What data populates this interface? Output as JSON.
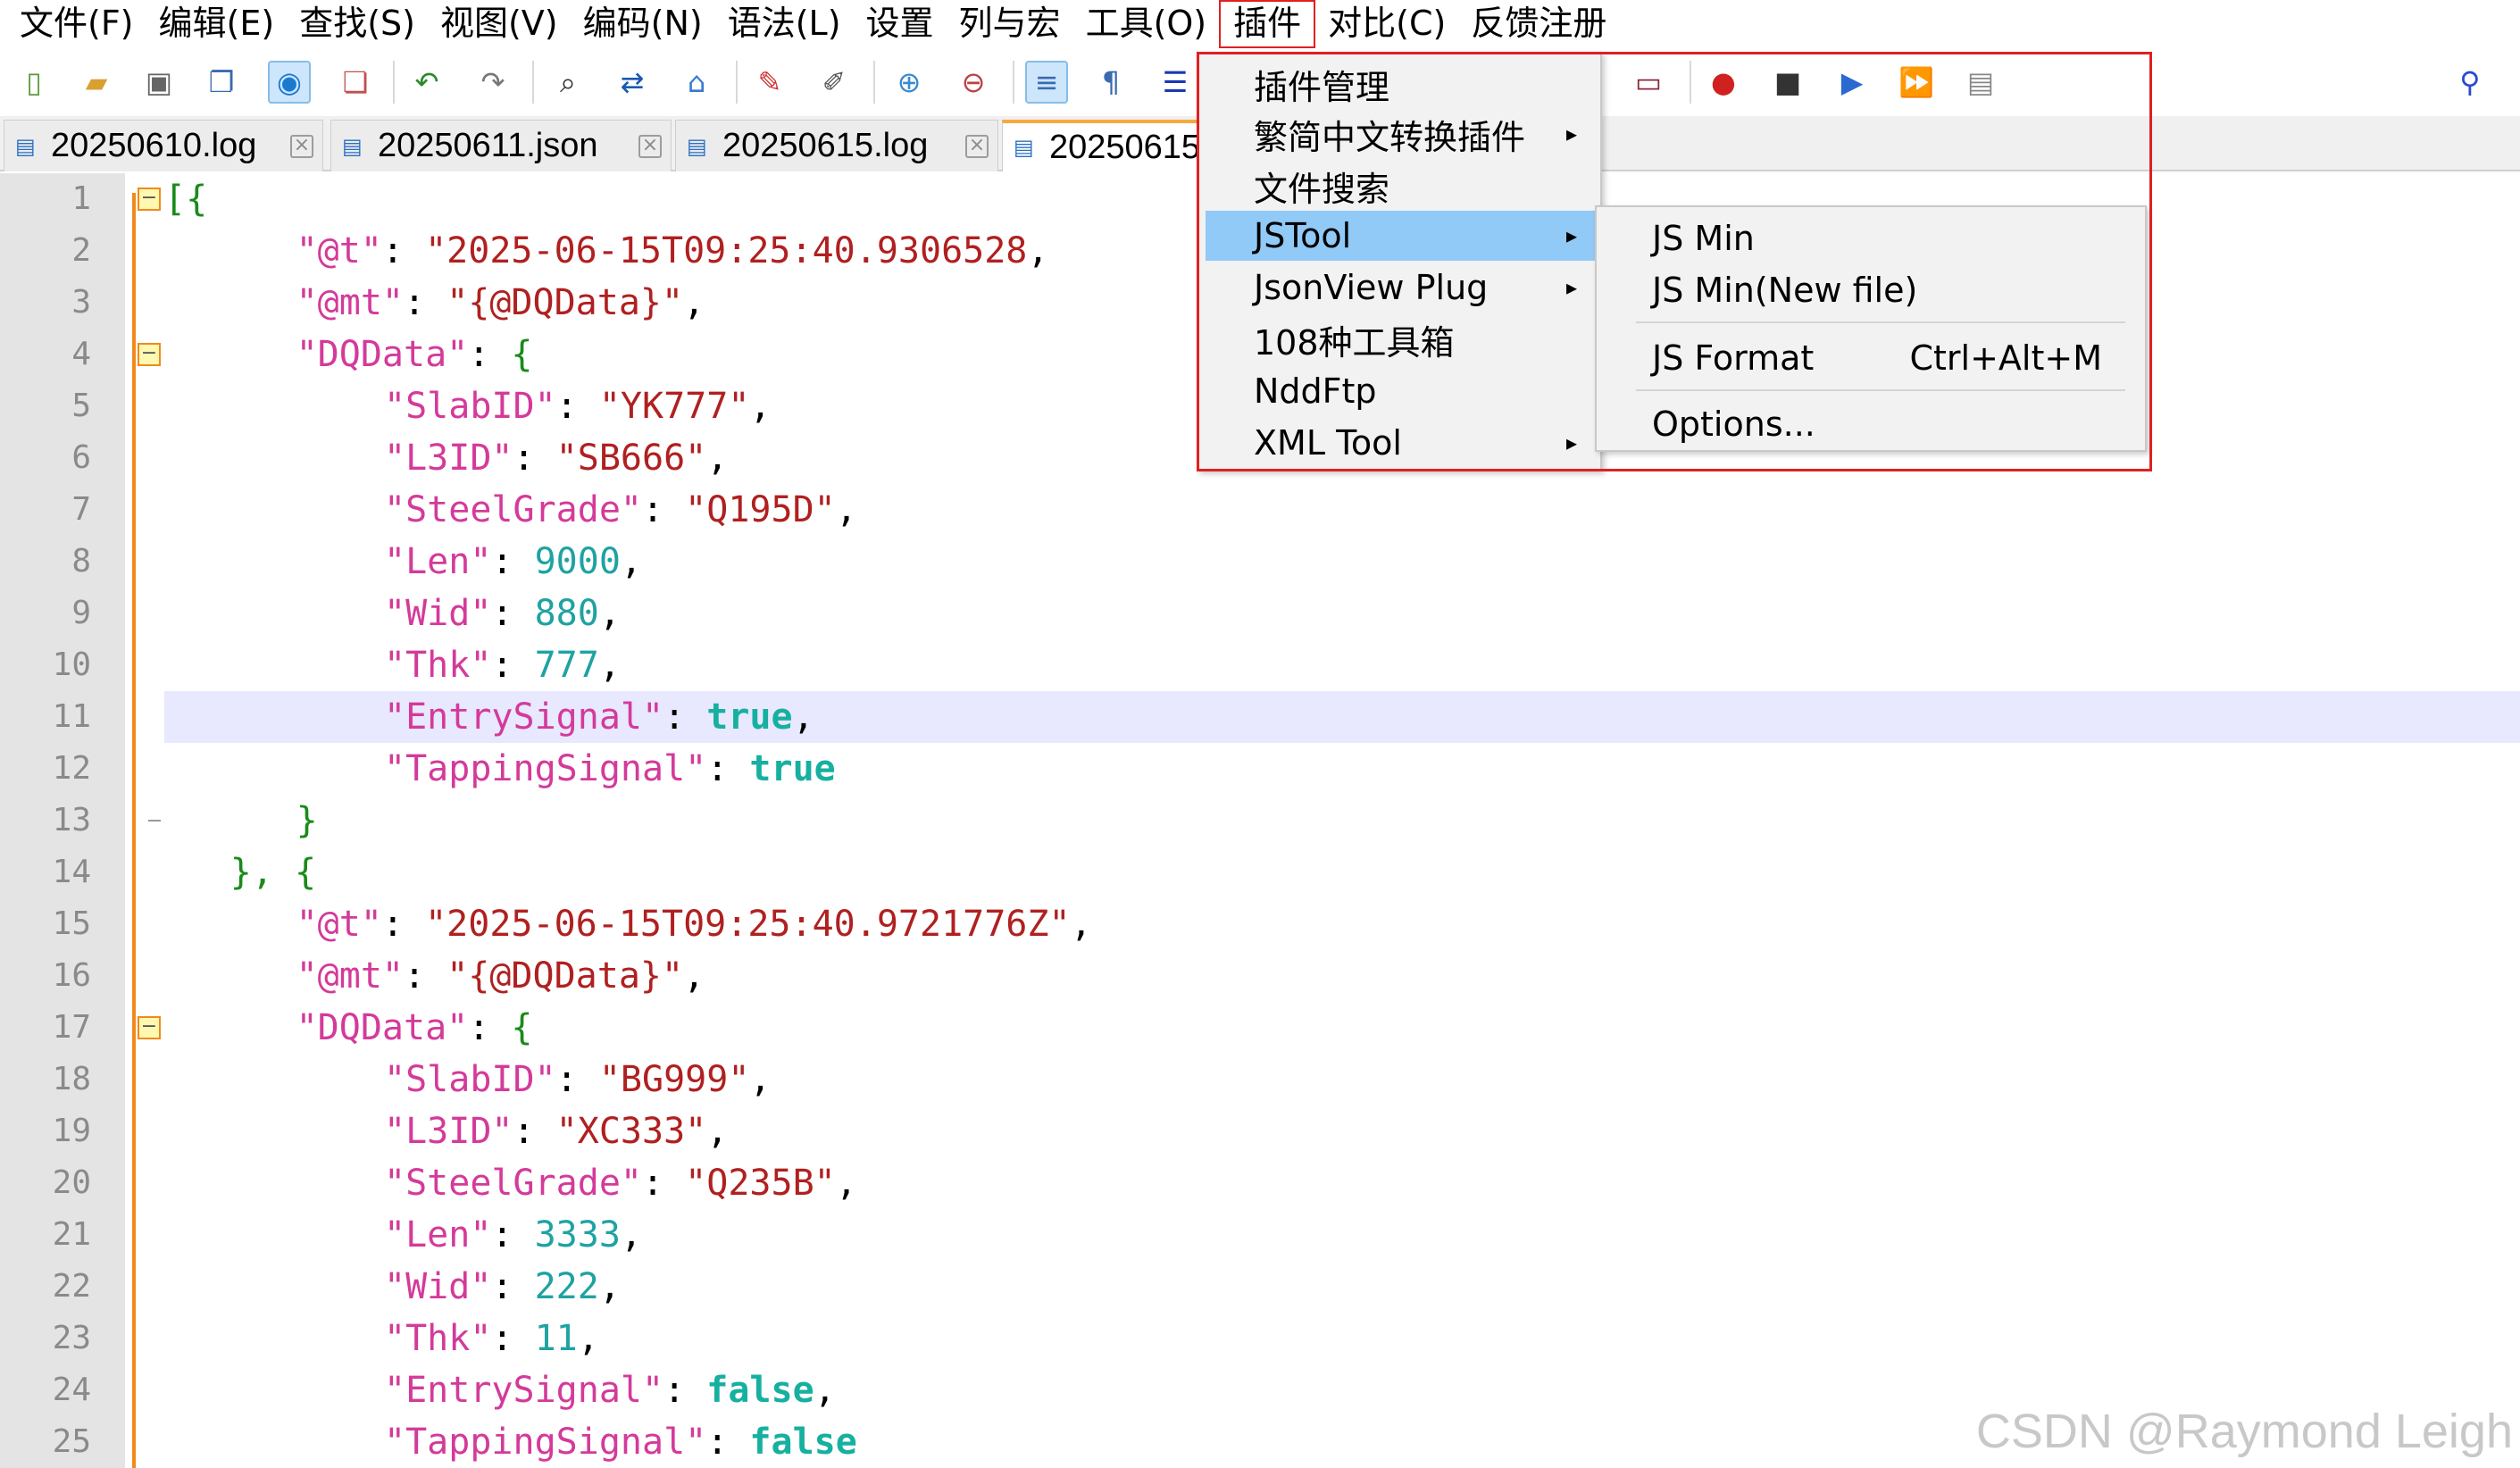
{
  "menubar": {
    "items": [
      "文件(F)",
      "编辑(E)",
      "查找(S)",
      "视图(V)",
      "编码(N)",
      "语法(L)",
      "设置",
      "列与宏",
      "工具(O)",
      "插件",
      "对比(C)",
      "反馈注册"
    ],
    "open_item": "插件"
  },
  "toolbar": {
    "icons": [
      "new-file-icon",
      "open-file-icon",
      "save-icon",
      "save-all-icon",
      "close-icon",
      "close-all-icon",
      "print-icon",
      "undo-icon",
      "redo-icon",
      "find-icon",
      "replace-icon",
      "bookmark-icon",
      "marker-icon",
      "eraser-icon",
      "zoom-in-icon",
      "zoom-out-icon",
      "word-wrap-icon",
      "show-symbols-icon",
      "indent-guide-icon",
      "monitor-icon",
      "record-macro-icon",
      "stop-macro-icon",
      "play-macro-icon",
      "run-macro-multiple-icon",
      "save-macro-icon",
      "pin-icon"
    ]
  },
  "tabs": [
    {
      "label": "20250610.log",
      "active": false
    },
    {
      "label": "20250611.json",
      "active": false
    },
    {
      "label": "20250615.log",
      "active": false
    },
    {
      "label": "20250615",
      "active": true
    }
  ],
  "editor": {
    "current_line": 11,
    "lines": [
      {
        "n": "1",
        "text": "[{"
      },
      {
        "n": "2",
        "key": "\"@t\"",
        "value": "\"2025-06-15T09:25:40.9306528"
      },
      {
        "n": "3",
        "key": "\"@mt\"",
        "value": "\"{@DQData}\""
      },
      {
        "n": "4",
        "key": "\"DQData\"",
        "open": "{"
      },
      {
        "n": "5",
        "key": "\"SlabID\"",
        "value": "\"YK777\""
      },
      {
        "n": "6",
        "key": "\"L3ID\"",
        "value": "\"SB666\""
      },
      {
        "n": "7",
        "key": "\"SteelGrade\"",
        "value": "\"Q195D\""
      },
      {
        "n": "8",
        "key": "\"Len\"",
        "value": "9000"
      },
      {
        "n": "9",
        "key": "\"Wid\"",
        "value": "880"
      },
      {
        "n": "10",
        "key": "\"Thk\"",
        "value": "777"
      },
      {
        "n": "11",
        "key": "\"EntrySignal\"",
        "value": "true"
      },
      {
        "n": "12",
        "key": "\"TappingSignal\"",
        "value": "true"
      },
      {
        "n": "13",
        "text": "}"
      },
      {
        "n": "14",
        "text": "}, {"
      },
      {
        "n": "15",
        "key": "\"@t\"",
        "value": "\"2025-06-15T09:25:40.9721776Z\""
      },
      {
        "n": "16",
        "key": "\"@mt\"",
        "value": "\"{@DQData}\""
      },
      {
        "n": "17",
        "key": "\"DQData\"",
        "open": "{"
      },
      {
        "n": "18",
        "key": "\"SlabID\"",
        "value": "\"BG999\""
      },
      {
        "n": "19",
        "key": "\"L3ID\"",
        "value": "\"XC333\""
      },
      {
        "n": "20",
        "key": "\"SteelGrade\"",
        "value": "\"Q235B\""
      },
      {
        "n": "21",
        "key": "\"Len\"",
        "value": "3333"
      },
      {
        "n": "22",
        "key": "\"Wid\"",
        "value": "222"
      },
      {
        "n": "23",
        "key": "\"Thk\"",
        "value": "11"
      },
      {
        "n": "24",
        "key": "\"EntrySignal\"",
        "value": "false"
      },
      {
        "n": "25",
        "key": "\"TappingSignal\"",
        "value": "false"
      }
    ]
  },
  "plugin_menu": {
    "items": [
      {
        "label": "插件管理",
        "submenu": false
      },
      {
        "label": "繁简中文转换插件",
        "submenu": true
      },
      {
        "label": "文件搜索",
        "submenu": false
      },
      {
        "label": "JSTool",
        "submenu": true,
        "hover": true
      },
      {
        "label": "JsonView Plug",
        "submenu": true
      },
      {
        "label": "108种工具箱",
        "submenu": false
      },
      {
        "label": "NddFtp",
        "submenu": false
      },
      {
        "label": "XML Tool",
        "submenu": true
      }
    ],
    "arrow_glyph": "▸"
  },
  "jstool_submenu": {
    "items": [
      {
        "label": "JS Min",
        "shortcut": ""
      },
      {
        "label": "JS Min(New file)",
        "shortcut": ""
      },
      {
        "label": "JS Format",
        "shortcut": "Ctrl+Alt+M"
      },
      {
        "label": "Options...",
        "shortcut": ""
      }
    ]
  },
  "colors": {
    "key": "#d43a9a",
    "string": "#b02020",
    "number": "#1fa2a2",
    "boolean": "#16b0a0",
    "highlight": "#e02020",
    "menu_hover": "#91c9f7",
    "current_line": "#e8e8ff"
  },
  "watermark": "CSDN @Raymond Leigh"
}
